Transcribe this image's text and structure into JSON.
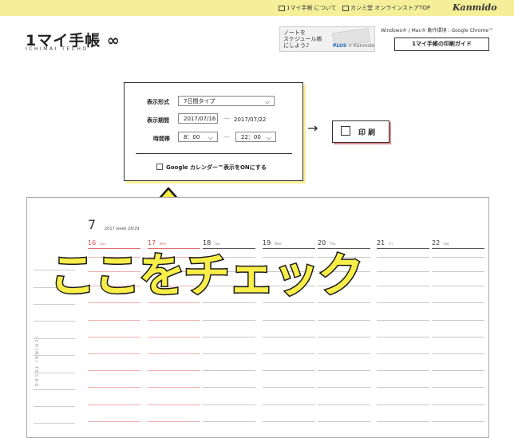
{
  "topbar": {
    "link1": "1マイ手帳 について",
    "link2": "カンミ堂 オンラインストアTOP",
    "brand": "Kanmido"
  },
  "header": {
    "logo": "1マイ手帳 ∞",
    "logo_sub": "ICHIMAI TECHO",
    "ad_text": "ノートを\nスケジュール帳\nにしよう♪",
    "ad_footer_plus": "PLUS",
    "ad_footer_rest": " × Kanmido",
    "env_text": "Windows® / Mac® 動作環境 : Google Chrome™",
    "guide_button": "1マイ手帳の印刷ガイド"
  },
  "form": {
    "format_label": "表示形式",
    "format_value": "7日間タイプ",
    "period_label": "表示期間",
    "period_start": "2017/07/16",
    "period_dash": "—",
    "period_end": "2017/07/22",
    "time_label": "時間帯",
    "time_start": "8：00",
    "time_dash": "—",
    "time_end": "22：00",
    "google_label": "Google カレンダー™表示をONにする",
    "google_checked": false,
    "chevron": "⌵"
  },
  "print": {
    "arrow": "→",
    "label": "印 刷"
  },
  "preview": {
    "month": "7",
    "week": "2017  week 28/29",
    "side_text": "ICHIMAI TECHO",
    "days": [
      {
        "num": "16",
        "name": "Sun"
      },
      {
        "num": "17",
        "name": "Mon"
      },
      {
        "num": "18",
        "name": "Tue"
      },
      {
        "num": "19",
        "name": "Wed"
      },
      {
        "num": "20",
        "name": "Thu"
      },
      {
        "num": "21",
        "name": "Fri"
      },
      {
        "num": "22",
        "name": "Sat"
      }
    ]
  },
  "overlay": {
    "text": "ここをチェック",
    "color": "#f8ee4a"
  }
}
